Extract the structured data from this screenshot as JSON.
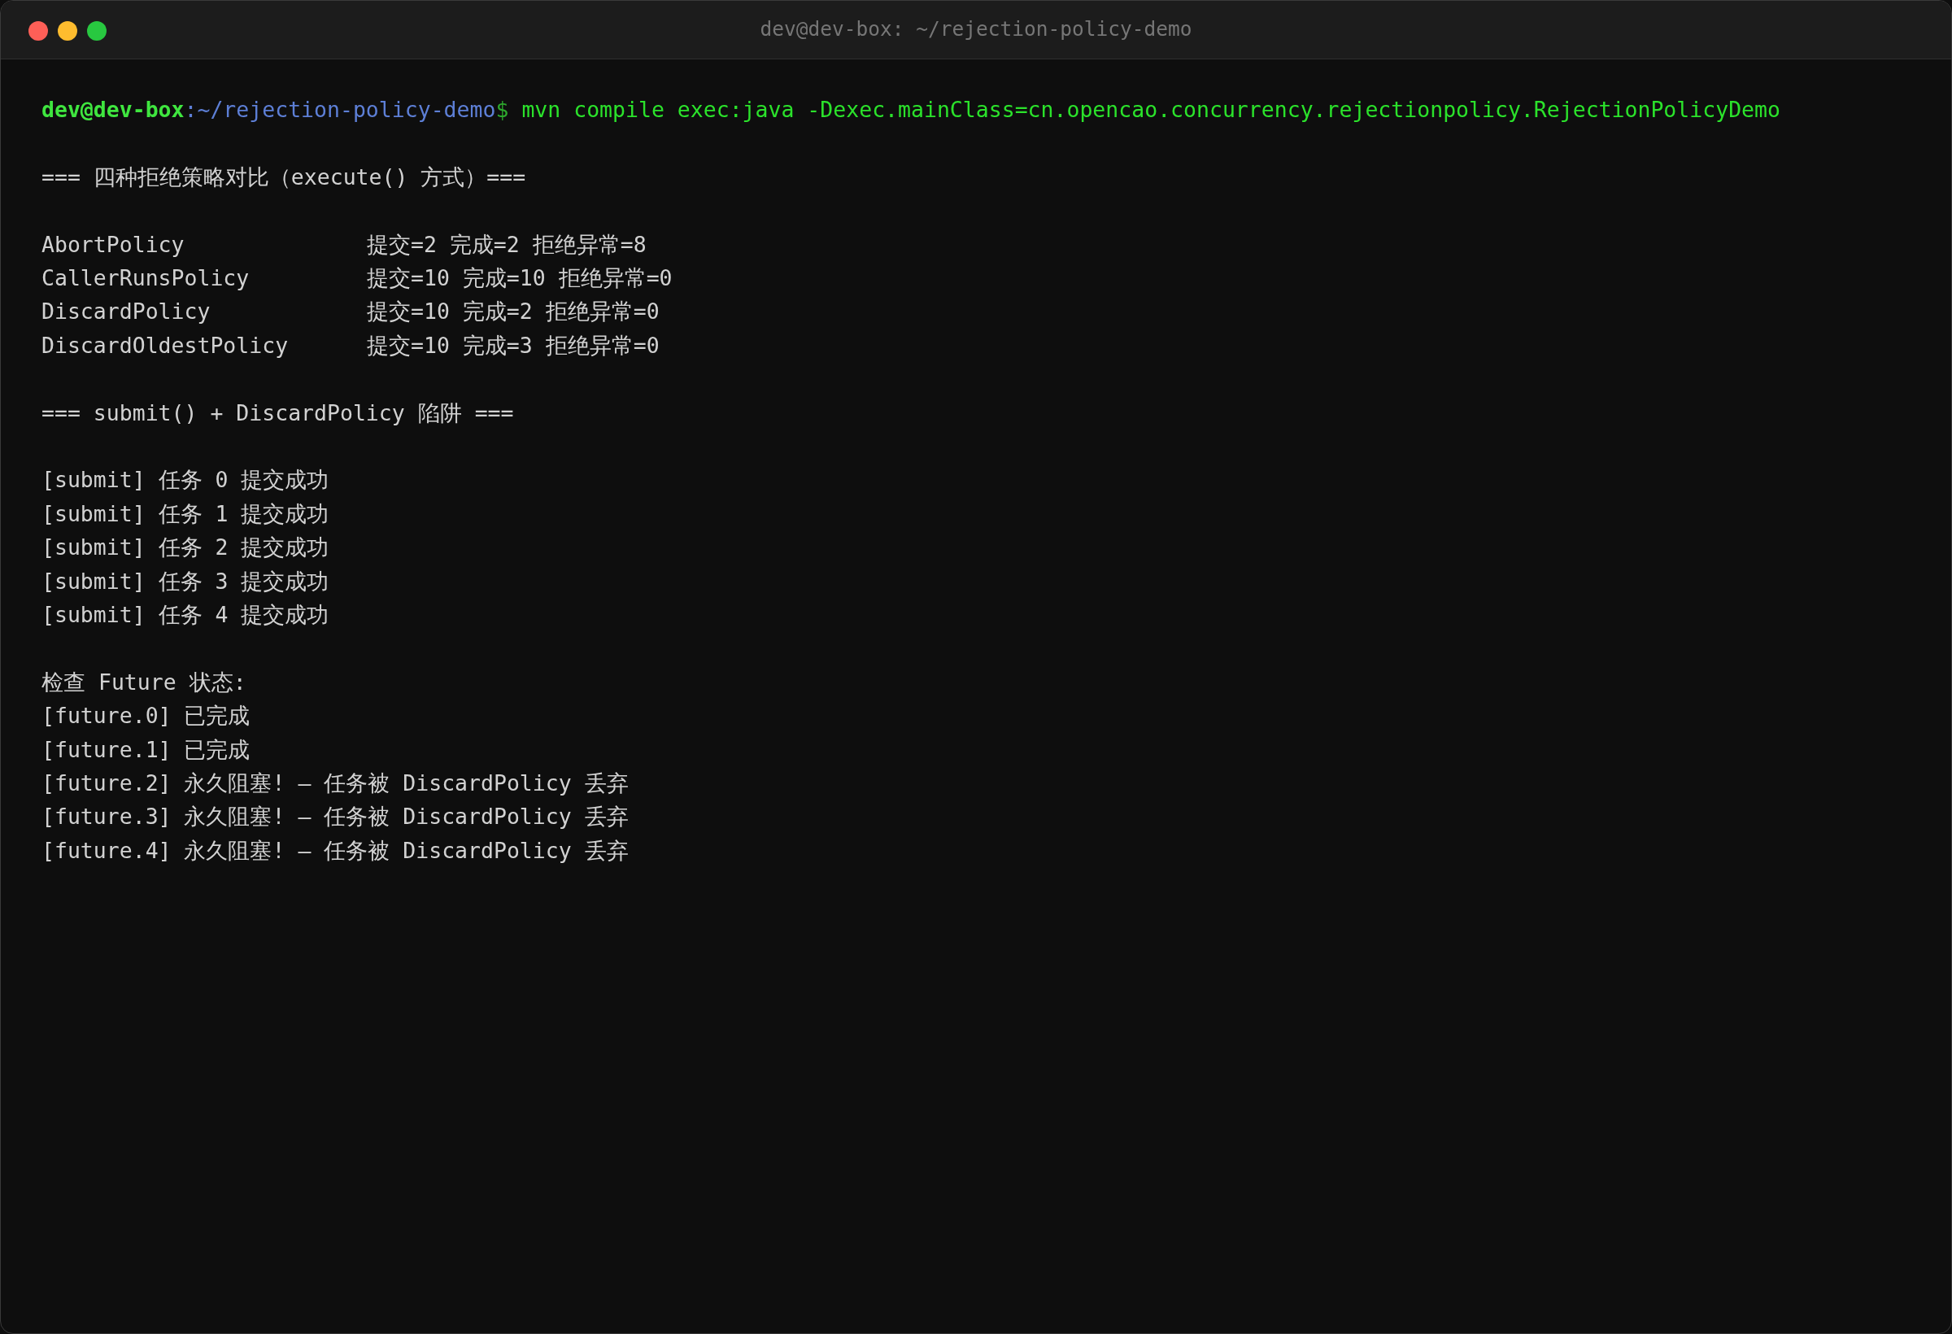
{
  "window": {
    "title": "dev@dev-box: ~/rejection-policy-demo"
  },
  "prompt": {
    "user_host": "dev@dev-box",
    "path": ":~/rejection-policy-demo",
    "symbol": "$",
    "command": "mvn compile exec:java -Dexec.mainClass=cn.opencao.concurrency.rejectionpolicy.RejectionPolicyDemo"
  },
  "output": [
    {
      "kind": "heading",
      "text": "=== 四种拒绝策略对比（execute() 方式）==="
    },
    {
      "kind": "table",
      "rows": [
        {
          "policy": "AbortPolicy",
          "result": "提交=2 完成=2 拒绝异常=8"
        },
        {
          "policy": "CallerRunsPolicy",
          "result": "提交=10 完成=10 拒绝异常=0"
        },
        {
          "policy": "DiscardPolicy",
          "result": "提交=10 完成=2 拒绝异常=0"
        },
        {
          "policy": "DiscardOldestPolicy",
          "result": "提交=10 完成=3 拒绝异常=0"
        }
      ]
    },
    {
      "kind": "heading",
      "text": "=== submit() + DiscardPolicy 陷阱 ==="
    },
    {
      "kind": "lines",
      "lines": [
        "[submit] 任务 0 提交成功",
        "[submit] 任务 1 提交成功",
        "[submit] 任务 2 提交成功",
        "[submit] 任务 3 提交成功",
        "[submit] 任务 4 提交成功"
      ]
    },
    {
      "kind": "lines",
      "lines": [
        "检查 Future 状态:",
        "[future.0] 已完成",
        "[future.1] 已完成",
        "[future.2] 永久阻塞! — 任务被 DiscardPolicy 丢弃",
        "[future.3] 永久阻塞! — 任务被 DiscardPolicy 丢弃",
        "[future.4] 永久阻塞! — 任务被 DiscardPolicy 丢弃"
      ]
    }
  ]
}
